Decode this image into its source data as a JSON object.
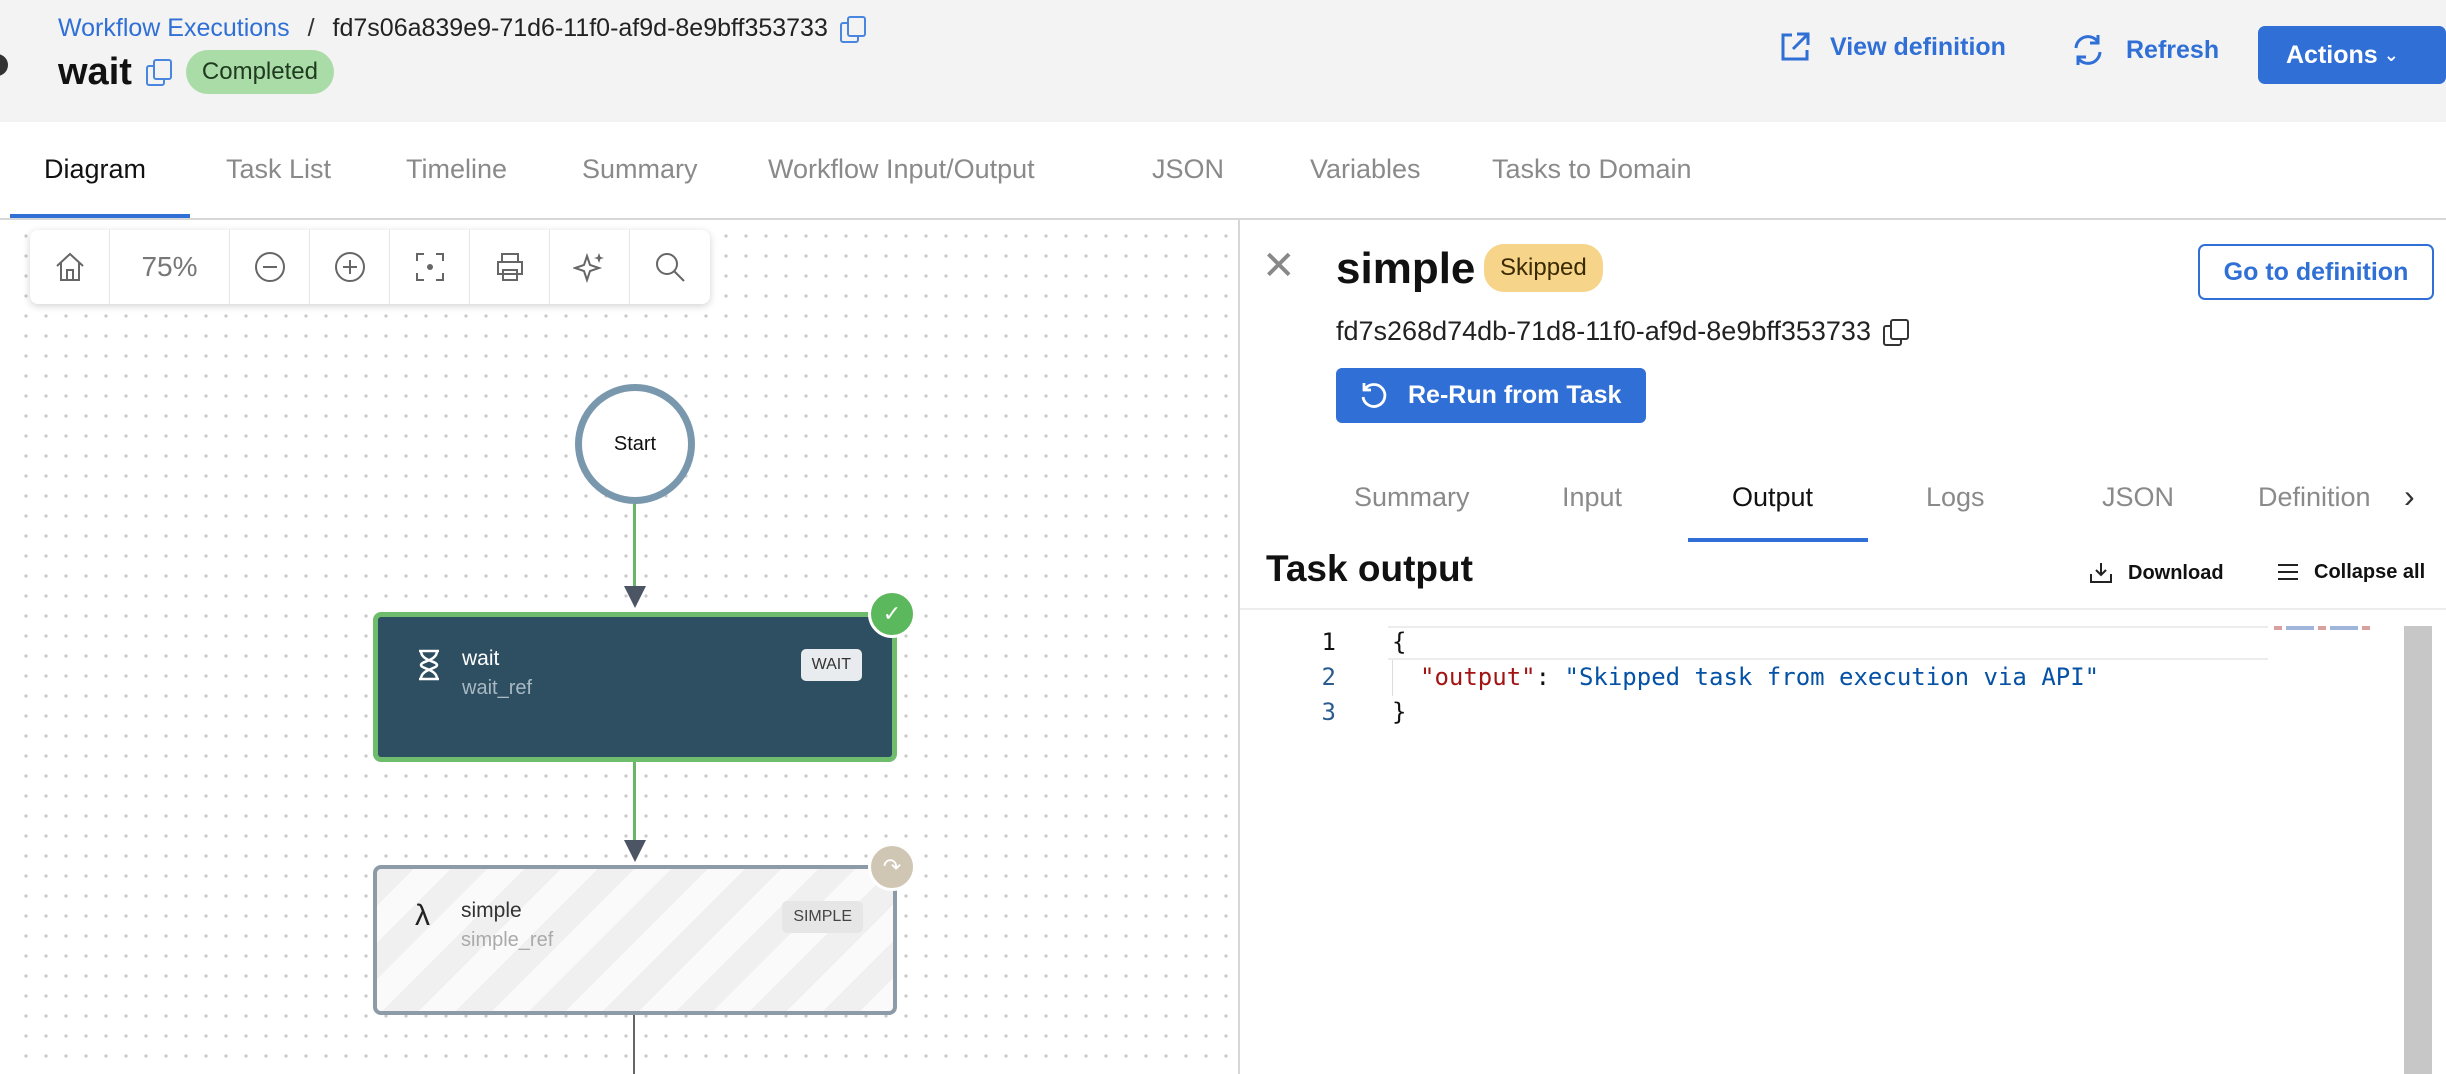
{
  "header": {
    "breadcrumb_link": "Workflow Executions",
    "breadcrumb_sep": "/",
    "execution_id": "fd7s06a839e9-71d6-11f0-af9d-8e9bff353733",
    "title": "wait",
    "status": "Completed",
    "view_definition_label": "View definition",
    "refresh_label": "Refresh",
    "actions_label": "Actions"
  },
  "tabs": [
    "Diagram",
    "Task List",
    "Timeline",
    "Summary",
    "Workflow Input/Output",
    "JSON",
    "Variables",
    "Tasks to Domain"
  ],
  "active_tab": "Diagram",
  "toolbar": {
    "zoom": "75%",
    "icons": [
      "home-icon",
      "zoom-out-icon",
      "zoom-in-icon",
      "fit-view-icon",
      "print-icon",
      "sparkle-icon",
      "search-icon"
    ]
  },
  "diagram": {
    "start_label": "Start",
    "nodes": [
      {
        "name": "wait",
        "ref": "wait_ref",
        "type": "WAIT",
        "status": "completed"
      },
      {
        "name": "simple",
        "ref": "simple_ref",
        "type": "SIMPLE",
        "status": "skipped"
      }
    ],
    "colors": {
      "completed": "#6dbd6d",
      "node_dark": "#2d4f61",
      "edge": "#6bb56b"
    }
  },
  "panel": {
    "title": "simple",
    "status": "Skipped",
    "go_to_definition_label": "Go to definition",
    "task_id": "fd7s268d74db-71d8-11f0-af9d-8e9bff353733",
    "rerun_label": "Re-Run from Task",
    "sub_tabs": [
      "Summary",
      "Input",
      "Output",
      "Logs",
      "JSON",
      "Definition"
    ],
    "active_sub_tab": "Output",
    "output_title": "Task output",
    "download_label": "Download",
    "collapse_label": "Collapse all",
    "code": {
      "line_numbers": [
        "1",
        "2",
        "3"
      ],
      "open_brace": "{",
      "key": "\"output\"",
      "colon": ": ",
      "value": "\"Skipped task from execution via API\"",
      "close_brace": "}"
    }
  },
  "colors": {
    "accent": "#2f6fd6",
    "completed_badge": "#a9dca7",
    "skipped_badge": "#f6d48a"
  }
}
